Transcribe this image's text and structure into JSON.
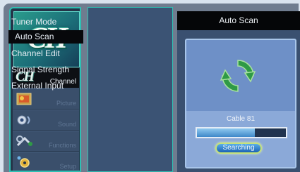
{
  "logo": {
    "text": "CH"
  },
  "sidebar": {
    "items": [
      {
        "label": "Channel",
        "icon": "ch-logo-icon",
        "active": true
      },
      {
        "label": "Picture",
        "icon": "picture-icon",
        "active": false
      },
      {
        "label": "Sound",
        "icon": "sound-icon",
        "active": false
      },
      {
        "label": "Functions",
        "icon": "functions-icon",
        "active": false
      },
      {
        "label": "Setup",
        "icon": "setup-icon",
        "active": false
      }
    ]
  },
  "submenu": {
    "items": [
      {
        "label": "Tuner Mode"
      },
      {
        "label": "Auto Scan",
        "selected": true
      },
      {
        "label": "Channel Edit"
      },
      {
        "label": "Signal Strength"
      },
      {
        "label": "External Input"
      }
    ]
  },
  "panel": {
    "title": "Auto Scan",
    "icon": "refresh-arrows-icon",
    "channel": "Cable 81",
    "progress": 0.65,
    "status": "Searching"
  },
  "colors": {
    "accent": "#2fbfb3",
    "icon_green": "#2f9a46",
    "selected_bg": "#07080b"
  }
}
